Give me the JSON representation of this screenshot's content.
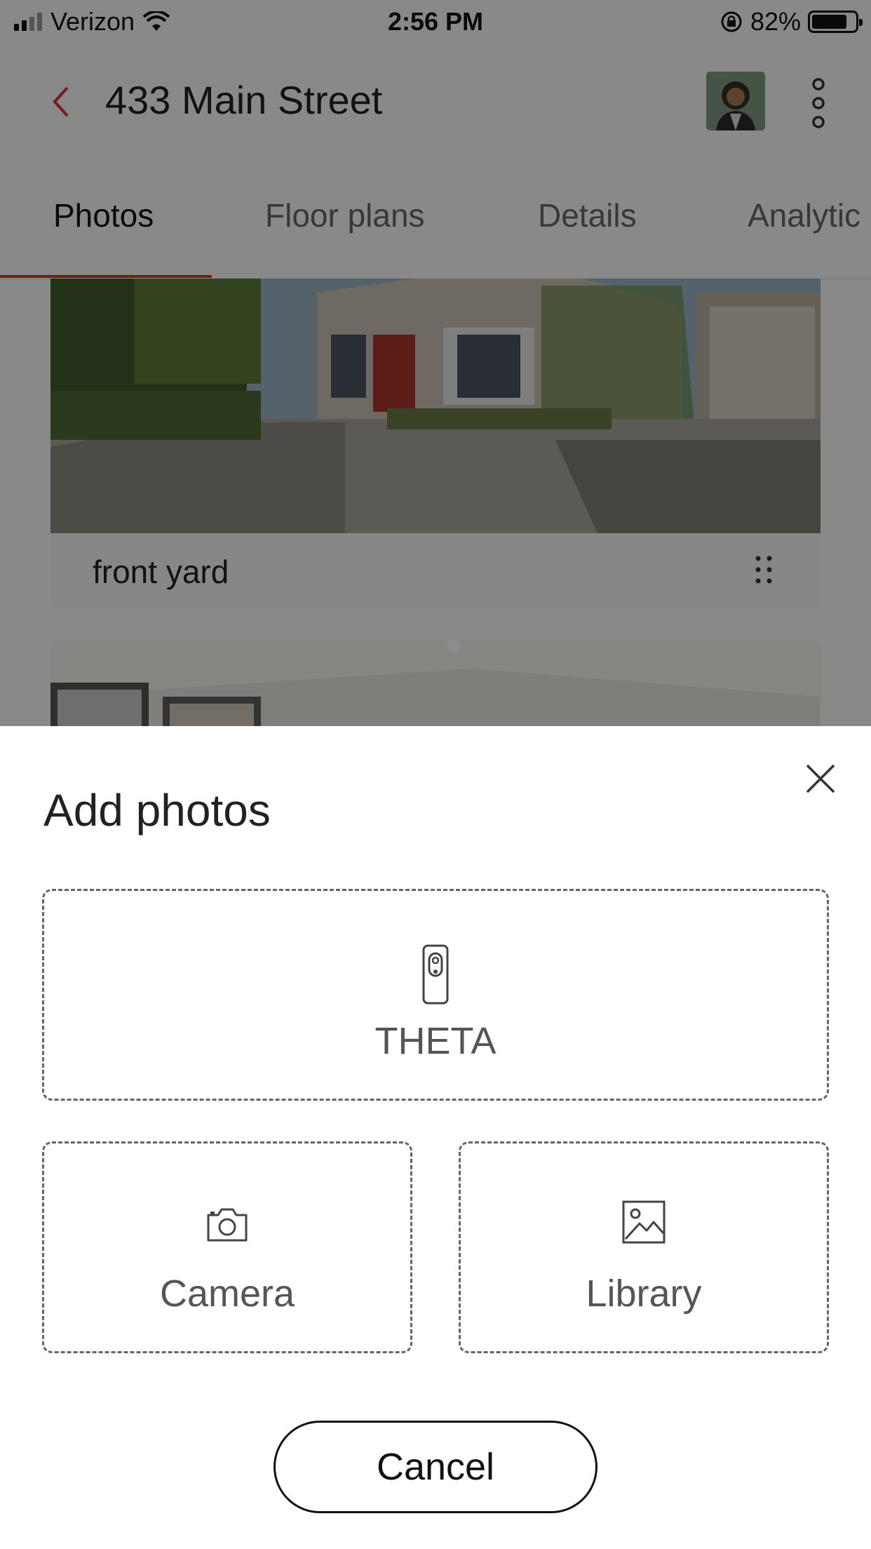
{
  "status_bar": {
    "carrier": "Verizon",
    "time": "2:56 PM",
    "battery": "82%"
  },
  "header": {
    "title": "433 Main Street",
    "icons": [
      "chevron-left-icon",
      "avatar",
      "more-vertical-icon"
    ]
  },
  "tabs": [
    {
      "label": "Photos",
      "active": true
    },
    {
      "label": "Floor plans",
      "active": false
    },
    {
      "label": "Details",
      "active": false
    },
    {
      "label": "Analytic",
      "active": false
    }
  ],
  "photos": [
    {
      "label": "front yard"
    }
  ],
  "sheet": {
    "title": "Add photos",
    "options": {
      "theta": "THETA",
      "camera": "Camera",
      "library": "Library"
    },
    "cancel": "Cancel"
  },
  "colors": {
    "accent": "#d6342d",
    "dashed_border": "#666666",
    "overlay": "rgba(0,0,0,0.45)"
  }
}
